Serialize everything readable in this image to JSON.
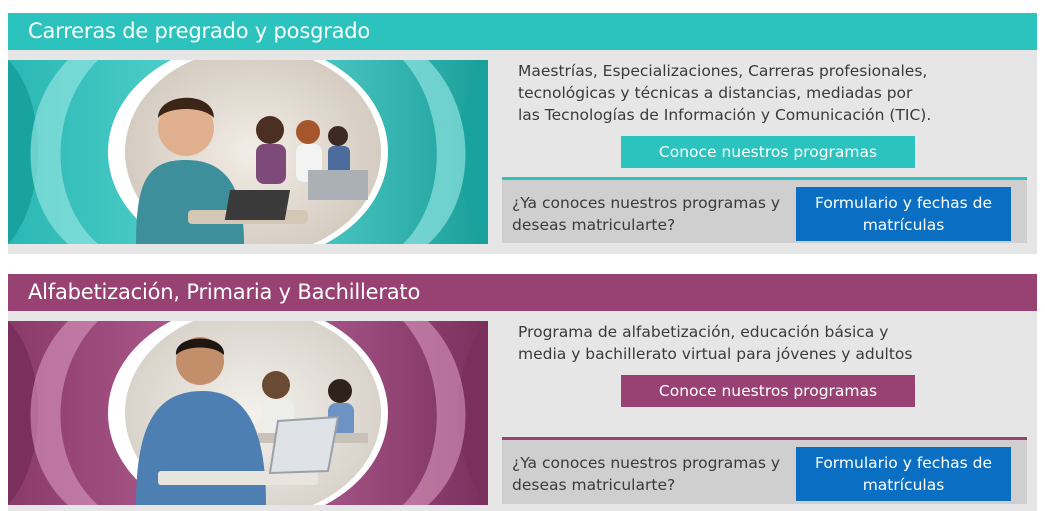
{
  "sections": [
    {
      "title": "Carreras de pregrado y posgrado",
      "accent": "#2cc2be",
      "image_icon": "students-in-classroom-photo",
      "description": "Maestrías, Especializaciones, Carreras profesionales, tecnológicas y técnicas a distancias, mediadas por las Tecnologías de Información y Comunicación (TIC).",
      "programs_button": "Conoce nuestros programas",
      "enroll_question": "¿Ya conoces nuestros programas y deseas matricularte?",
      "form_button": "Formulario y fechas de matrículas"
    },
    {
      "title": "Alfabetización, Primaria y Bachillerato",
      "accent": "#984274",
      "image_icon": "student-with-laptop-photo",
      "description": "Programa de alfabetización, educación básica y media y bachillerato virtual para jóvenes y adultos",
      "programs_button": "Conoce nuestros programas",
      "enroll_question": "¿Ya conoces nuestros programas y deseas matricularte?",
      "form_button": "Formulario y fechas de matrículas"
    }
  ],
  "colors": {
    "form_button": "#0a6fc2",
    "card_background": "#e6e6e6",
    "enroll_background": "#cfcfcf"
  }
}
